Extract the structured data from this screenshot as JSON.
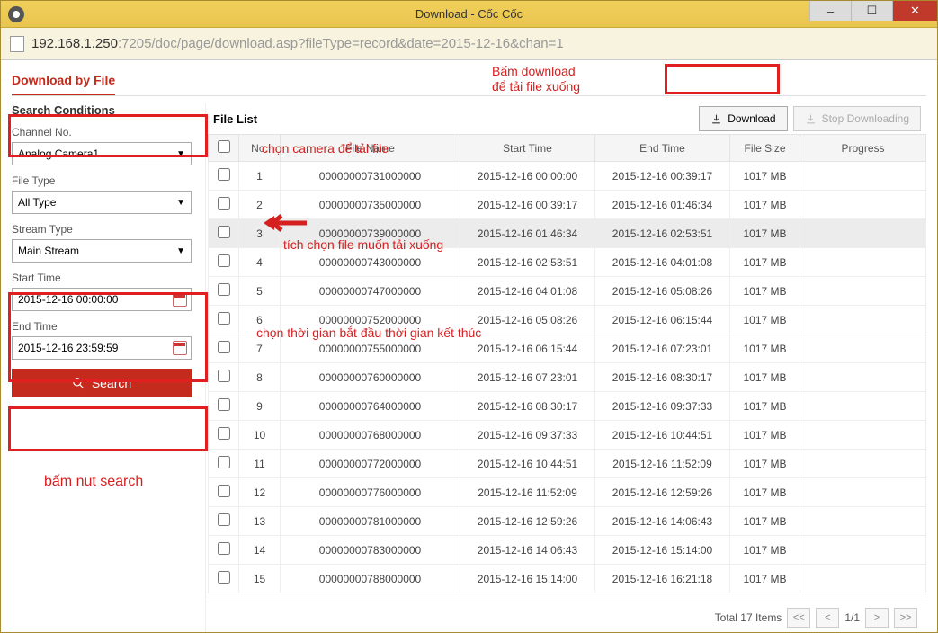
{
  "window": {
    "title": "Download - Cốc Cốc"
  },
  "addressbar": {
    "url_dark": "192.168.1.250",
    "url_rest": ":7205/doc/page/download.asp?fileType=record&date=2015-12-16&chan=1"
  },
  "tab": {
    "label": "Download by File"
  },
  "sidebar": {
    "title": "Search Conditions",
    "channel_label": "Channel No.",
    "channel_value": "Analog Camera1",
    "filetype_label": "File Type",
    "filetype_value": "All Type",
    "streamtype_label": "Stream Type",
    "streamtype_value": "Main Stream",
    "start_label": "Start Time",
    "start_value": "2015-12-16 00:00:00",
    "end_label": "End Time",
    "end_value": "2015-12-16 23:59:59",
    "search_label": "Search"
  },
  "filelist": {
    "title": "File List",
    "download_label": "Download",
    "stop_label": "Stop Downloading",
    "columns": {
      "no": "No.",
      "filename": "File Name",
      "start": "Start Time",
      "end": "End Time",
      "size": "File Size",
      "progress": "Progress"
    },
    "rows": [
      {
        "no": "1",
        "fn": "00000000731000000",
        "st": "2015-12-16 00:00:00",
        "et": "2015-12-16 00:39:17",
        "fs": "1017 MB"
      },
      {
        "no": "2",
        "fn": "00000000735000000",
        "st": "2015-12-16 00:39:17",
        "et": "2015-12-16 01:46:34",
        "fs": "1017 MB"
      },
      {
        "no": "3",
        "fn": "00000000739000000",
        "st": "2015-12-16 01:46:34",
        "et": "2015-12-16 02:53:51",
        "fs": "1017 MB"
      },
      {
        "no": "4",
        "fn": "00000000743000000",
        "st": "2015-12-16 02:53:51",
        "et": "2015-12-16 04:01:08",
        "fs": "1017 MB"
      },
      {
        "no": "5",
        "fn": "00000000747000000",
        "st": "2015-12-16 04:01:08",
        "et": "2015-12-16 05:08:26",
        "fs": "1017 MB"
      },
      {
        "no": "6",
        "fn": "00000000752000000",
        "st": "2015-12-16 05:08:26",
        "et": "2015-12-16 06:15:44",
        "fs": "1017 MB"
      },
      {
        "no": "7",
        "fn": "00000000755000000",
        "st": "2015-12-16 06:15:44",
        "et": "2015-12-16 07:23:01",
        "fs": "1017 MB"
      },
      {
        "no": "8",
        "fn": "00000000760000000",
        "st": "2015-12-16 07:23:01",
        "et": "2015-12-16 08:30:17",
        "fs": "1017 MB"
      },
      {
        "no": "9",
        "fn": "00000000764000000",
        "st": "2015-12-16 08:30:17",
        "et": "2015-12-16 09:37:33",
        "fs": "1017 MB"
      },
      {
        "no": "10",
        "fn": "00000000768000000",
        "st": "2015-12-16 09:37:33",
        "et": "2015-12-16 10:44:51",
        "fs": "1017 MB"
      },
      {
        "no": "11",
        "fn": "00000000772000000",
        "st": "2015-12-16 10:44:51",
        "et": "2015-12-16 11:52:09",
        "fs": "1017 MB"
      },
      {
        "no": "12",
        "fn": "00000000776000000",
        "st": "2015-12-16 11:52:09",
        "et": "2015-12-16 12:59:26",
        "fs": "1017 MB"
      },
      {
        "no": "13",
        "fn": "00000000781000000",
        "st": "2015-12-16 12:59:26",
        "et": "2015-12-16 14:06:43",
        "fs": "1017 MB"
      },
      {
        "no": "14",
        "fn": "00000000783000000",
        "st": "2015-12-16 14:06:43",
        "et": "2015-12-16 15:14:00",
        "fs": "1017 MB"
      },
      {
        "no": "15",
        "fn": "00000000788000000",
        "st": "2015-12-16 15:14:00",
        "et": "2015-12-16 16:21:18",
        "fs": "1017 MB"
      }
    ],
    "total_label": "Total 17 Items",
    "page": "1/1"
  },
  "annotations": {
    "a1": "Bấm download để tải file xuống",
    "a2": "chọn camera để tải file",
    "a3": "tích chọn file muốn tải xuống",
    "a4": "chọn thời gian bắt đầu thời gian kết thúc",
    "a5": "bấm nut search"
  }
}
